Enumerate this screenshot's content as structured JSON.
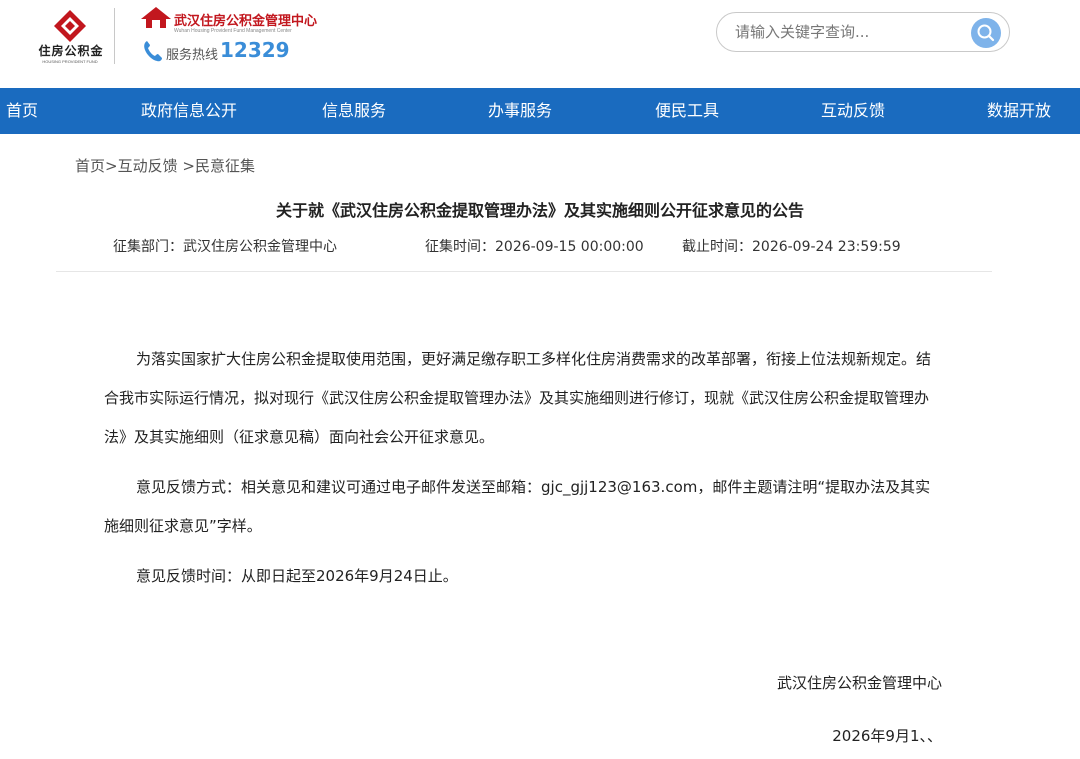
{
  "header": {
    "logo_text": "住房公积金",
    "org_name": "武汉住房公积金管理中心",
    "hotline_label": "服务热线",
    "hotline_number": "12329"
  },
  "search": {
    "placeholder": "请输入关键字查询..."
  },
  "nav": {
    "items": [
      {
        "label": "首页"
      },
      {
        "label": "政府信息公开"
      },
      {
        "label": "信息服务"
      },
      {
        "label": "办事服务"
      },
      {
        "label": "便民工具"
      },
      {
        "label": "互动反馈"
      },
      {
        "label": "数据开放"
      }
    ]
  },
  "breadcrumb": {
    "home": "首页",
    "sep1": ">",
    "section": "互动反馈",
    "sep2": " >",
    "current": "民意征集"
  },
  "article": {
    "title": "关于就《武汉住房公积金提取管理办法》及其实施细则公开征求意见的公告",
    "department": "征集部门：武汉住房公积金管理中心",
    "start_time": "征集时间：2026-09-15 00:00:00",
    "end_time": "截止时间：2026-09-24 23:59:59",
    "paragraphs": [
      "为落实国家扩大住房公积金提取使用范围，更好满足缴存职工多样化住房消费需求的改革部署，衔接上位法规新规定。结合我市实际运行情况，拟对现行《武汉住房公积金提取管理办法》及其实施细则进行修订，现就《武汉住房公积金提取管理办法》及其实施细则（征求意见稿）面向社会公开征求意见。",
      "意见反馈方式：相关意见和建议可通过电子邮件发送至邮箱：gjc_gjj123@163.com，邮件主题请注明“提取办法及其实施细则征求意见”字样。",
      "意见反馈时间：从即日起至2026年9月24日止。"
    ],
    "signature_org": "武汉住房公积金管理中心",
    "signature_date": "2026年9月1、、"
  },
  "colors": {
    "nav_bg": "#1a6bbf",
    "brand_red": "#c2171e",
    "hotline_blue": "#3a8dd8",
    "search_btn": "#7eb3ea"
  }
}
